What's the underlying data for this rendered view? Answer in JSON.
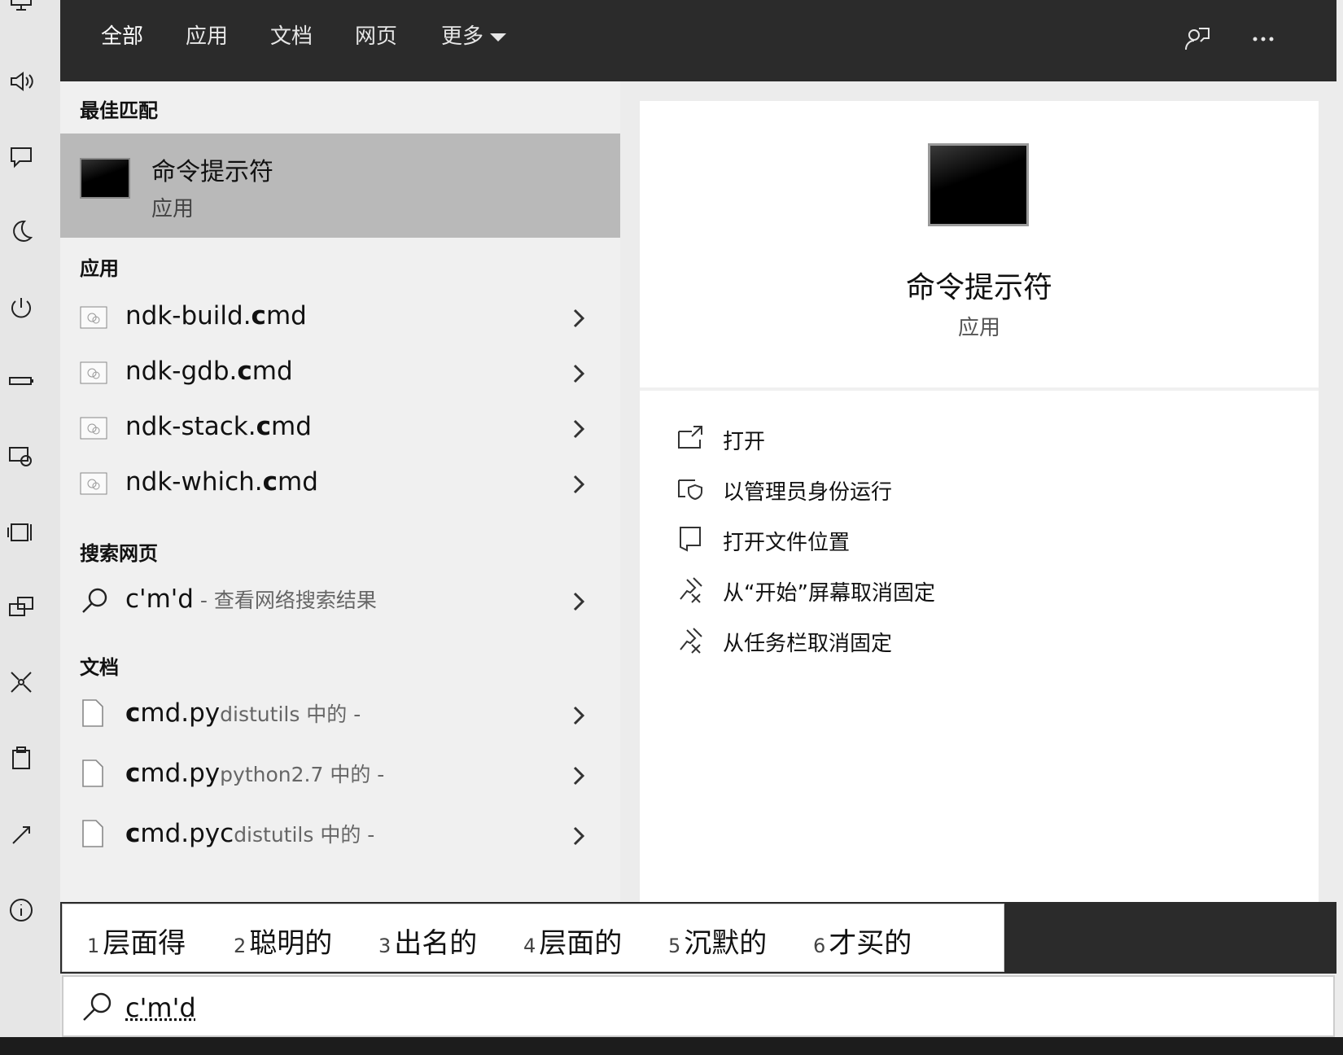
{
  "nav": {
    "tabs": [
      "全部",
      "应用",
      "文档",
      "网页",
      "更多"
    ]
  },
  "best_match": {
    "heading": "最佳匹配",
    "title": "命令提示符",
    "subtitle": "应用"
  },
  "apps": {
    "heading": "应用",
    "items": [
      {
        "prefix": "ndk-build.",
        "bold": "c",
        "rest": "md"
      },
      {
        "prefix": "ndk-gdb.",
        "bold": "c",
        "rest": "md"
      },
      {
        "prefix": "ndk-stack.",
        "bold": "c",
        "rest": "md"
      },
      {
        "prefix": "ndk-which.",
        "bold": "c",
        "rest": "md"
      }
    ]
  },
  "web": {
    "heading": "搜索网页",
    "query": "c'm'd",
    "suffix": " - 查看网络搜索结果"
  },
  "docs": {
    "heading": "文档",
    "items": [
      {
        "name": "cmd.py",
        "bold": "c",
        "rest": "md.py",
        "detail": "distutils 中的 -"
      },
      {
        "name": "cmd.py",
        "bold": "c",
        "rest": "md.py",
        "detail": "python2.7 中的 -"
      },
      {
        "name": "cmd.pyc",
        "bold": "c",
        "rest": "md.pyc",
        "detail": "distutils 中的 -"
      }
    ]
  },
  "preview": {
    "title": "命令提示符",
    "subtitle": "应用",
    "actions": [
      "打开",
      "以管理员身份运行",
      "打开文件位置",
      "从“开始”屏幕取消固定",
      "从任务栏取消固定"
    ]
  },
  "ime": {
    "candidates": [
      {
        "num": "1",
        "text": "层面得"
      },
      {
        "num": "2",
        "text": "聪明的"
      },
      {
        "num": "3",
        "text": "出名的"
      },
      {
        "num": "4",
        "text": "层面的"
      },
      {
        "num": "5",
        "text": "沉默的"
      },
      {
        "num": "6",
        "text": "才买的"
      }
    ]
  },
  "search": {
    "value": "c'm'd"
  }
}
